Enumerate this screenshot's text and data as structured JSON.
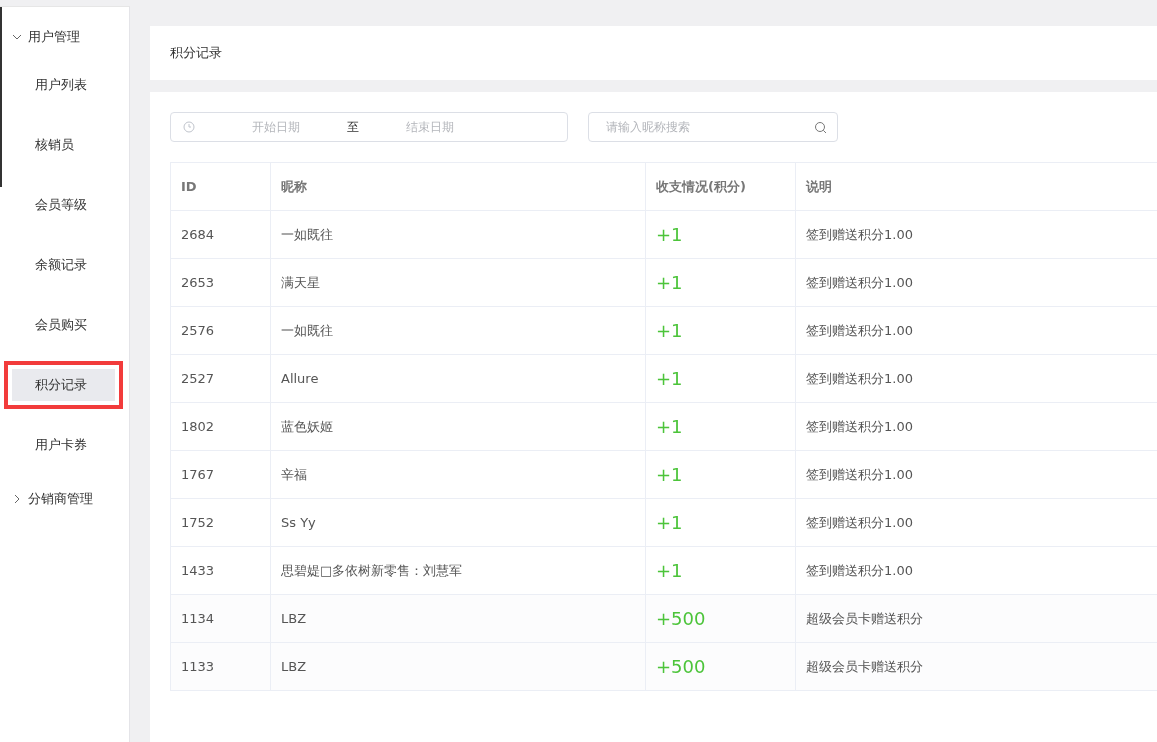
{
  "sidebar": {
    "groups": [
      {
        "label": "用户管理",
        "expanded": true,
        "children": [
          {
            "label": "用户列表",
            "selected": false
          },
          {
            "label": "核销员",
            "selected": false
          },
          {
            "label": "会员等级",
            "selected": false
          },
          {
            "label": "余额记录",
            "selected": false
          },
          {
            "label": "会员购买",
            "selected": false
          },
          {
            "label": "积分记录",
            "selected": true
          },
          {
            "label": "用户卡券",
            "selected": false
          }
        ]
      },
      {
        "label": "分销商管理",
        "expanded": false
      }
    ]
  },
  "header": {
    "title": "积分记录"
  },
  "filters": {
    "start_date": {
      "placeholder": "开始日期"
    },
    "separator": "至",
    "end_date": {
      "placeholder": "结束日期"
    },
    "search": {
      "placeholder": "请输入昵称搜索"
    }
  },
  "table": {
    "columns": [
      "ID",
      "昵称",
      "收支情况(积分)",
      "说明"
    ],
    "rows": [
      {
        "id": "2684",
        "nickname": "一如既往",
        "points": "+1",
        "note": "签到赠送积分1.00"
      },
      {
        "id": "2653",
        "nickname": "满天星",
        "points": "+1",
        "note": "签到赠送积分1.00"
      },
      {
        "id": "2576",
        "nickname": "一如既往",
        "points": "+1",
        "note": "签到赠送积分1.00"
      },
      {
        "id": "2527",
        "nickname": "Allure",
        "points": "+1",
        "note": "签到赠送积分1.00"
      },
      {
        "id": "1802",
        "nickname": "蓝色妖姬",
        "points": "+1",
        "note": "签到赠送积分1.00"
      },
      {
        "id": "1767",
        "nickname": "辛福",
        "points": "+1",
        "note": "签到赠送积分1.00"
      },
      {
        "id": "1752",
        "nickname": "Ss Yy",
        "points": "+1",
        "note": "签到赠送积分1.00"
      },
      {
        "id": "1433",
        "nickname": "思碧媞□多依树新零售：刘慧军",
        "points": "+1",
        "note": "签到赠送积分1.00"
      },
      {
        "id": "1134",
        "nickname": "LBZ",
        "points": "+500",
        "note": "超级会员卡赠送积分"
      },
      {
        "id": "1133",
        "nickname": "LBZ",
        "points": "+500",
        "note": "超级会员卡赠送积分"
      }
    ]
  }
}
